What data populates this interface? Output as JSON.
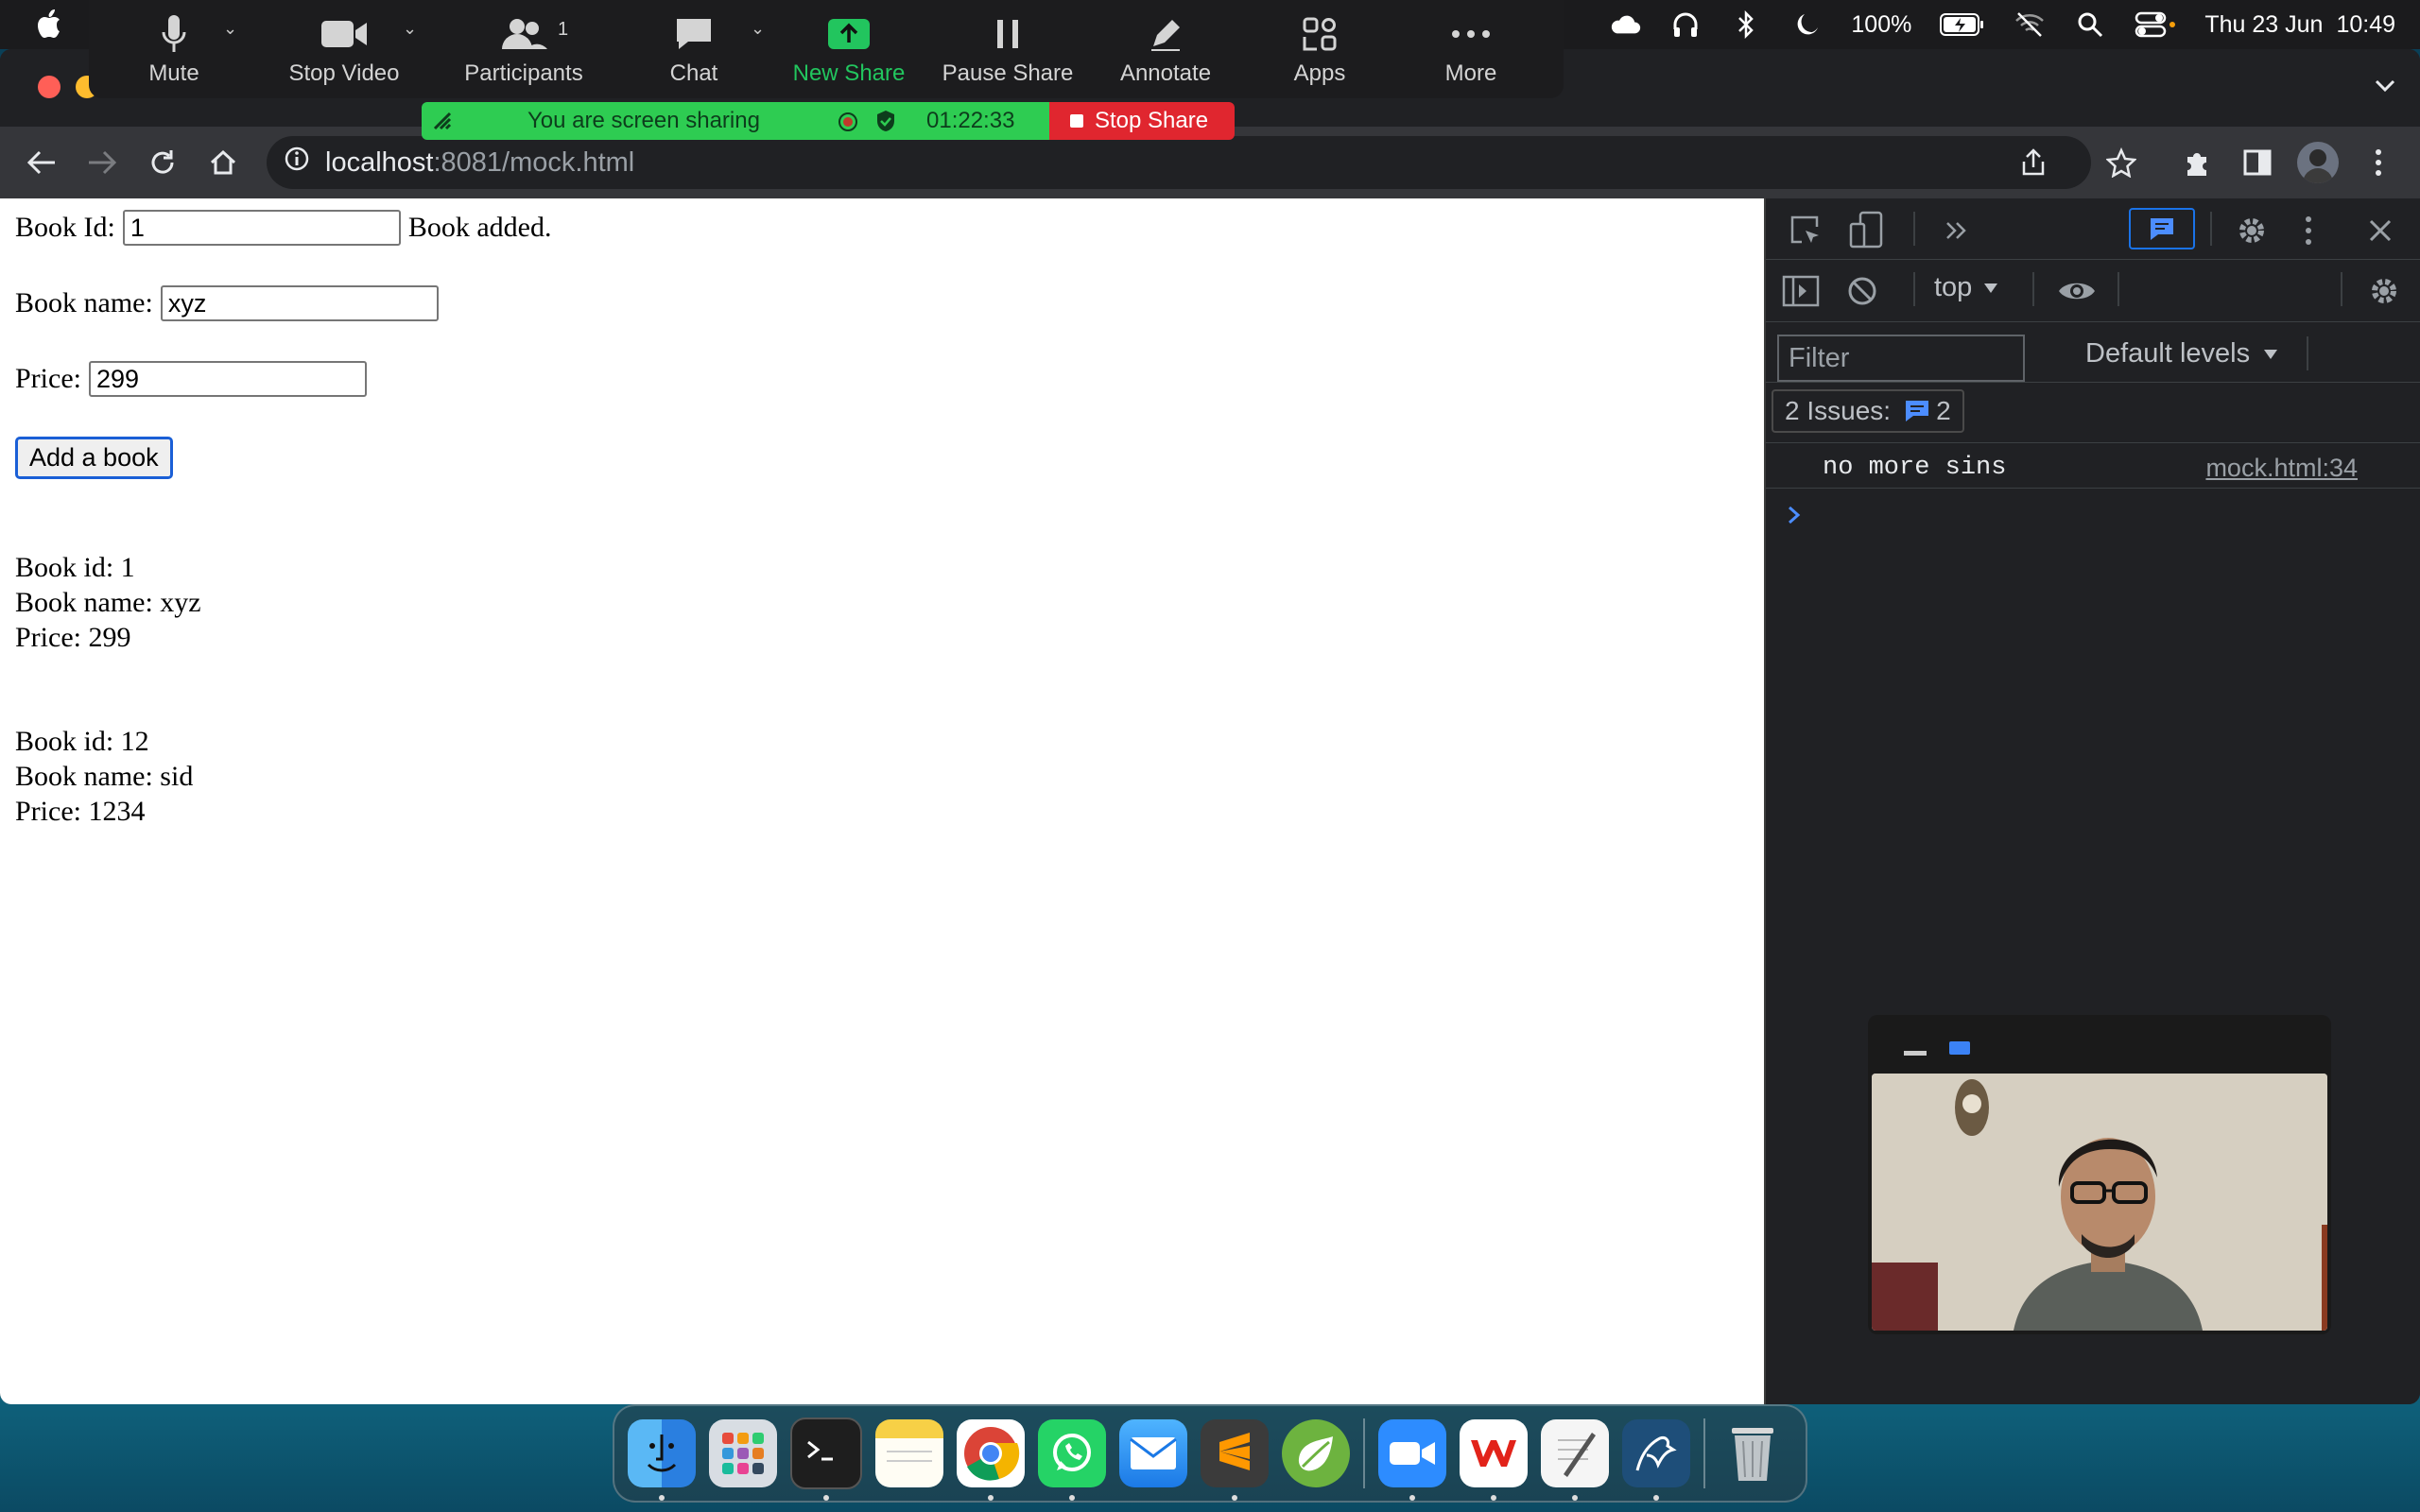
{
  "menubar": {
    "battery": "100%",
    "date": "Thu 23 Jun",
    "time": "10:49"
  },
  "zoom_toolbar": {
    "items": [
      {
        "label": "Mute",
        "icon": "microphone-icon"
      },
      {
        "label": "Stop Video",
        "icon": "video-camera-icon"
      },
      {
        "label": "Participants",
        "icon": "participants-icon",
        "count": "1"
      },
      {
        "label": "Chat",
        "icon": "chat-icon"
      },
      {
        "label": "New Share",
        "icon": "share-up-arrow-icon"
      },
      {
        "label": "Pause Share",
        "icon": "pause-icon"
      },
      {
        "label": "Annotate",
        "icon": "pencil-icon"
      },
      {
        "label": "Apps",
        "icon": "apps-icon"
      },
      {
        "label": "More",
        "icon": "more-dots-icon"
      }
    ],
    "accent_color": "#22c55e"
  },
  "share_banner": {
    "status": "You are screen sharing",
    "timer": "01:22:33",
    "stop_label": "Stop Share"
  },
  "browser": {
    "address_host": "localhost",
    "address_path": ":8081/mock.html"
  },
  "page": {
    "book_id_label": "Book Id:",
    "book_id_value": "1",
    "status_message": "Book added.",
    "book_name_label": "Book name:",
    "book_name_value": "xyz",
    "price_label": "Price:",
    "price_value": "299",
    "add_button": "Add a book",
    "books": [
      {
        "id_line": "Book id: 1",
        "name_line": "Book name: xyz",
        "price_line": "Price: 299"
      },
      {
        "id_line": "Book id: 12",
        "name_line": "Book name: sid",
        "price_line": "Price: 1234"
      }
    ]
  },
  "devtools": {
    "context": "top",
    "filter_placeholder": "Filter",
    "levels": "Default levels",
    "issues_label": "2 Issues:",
    "issues_count": "2",
    "log_message": "no more sins",
    "log_source": "mock.html:34"
  }
}
